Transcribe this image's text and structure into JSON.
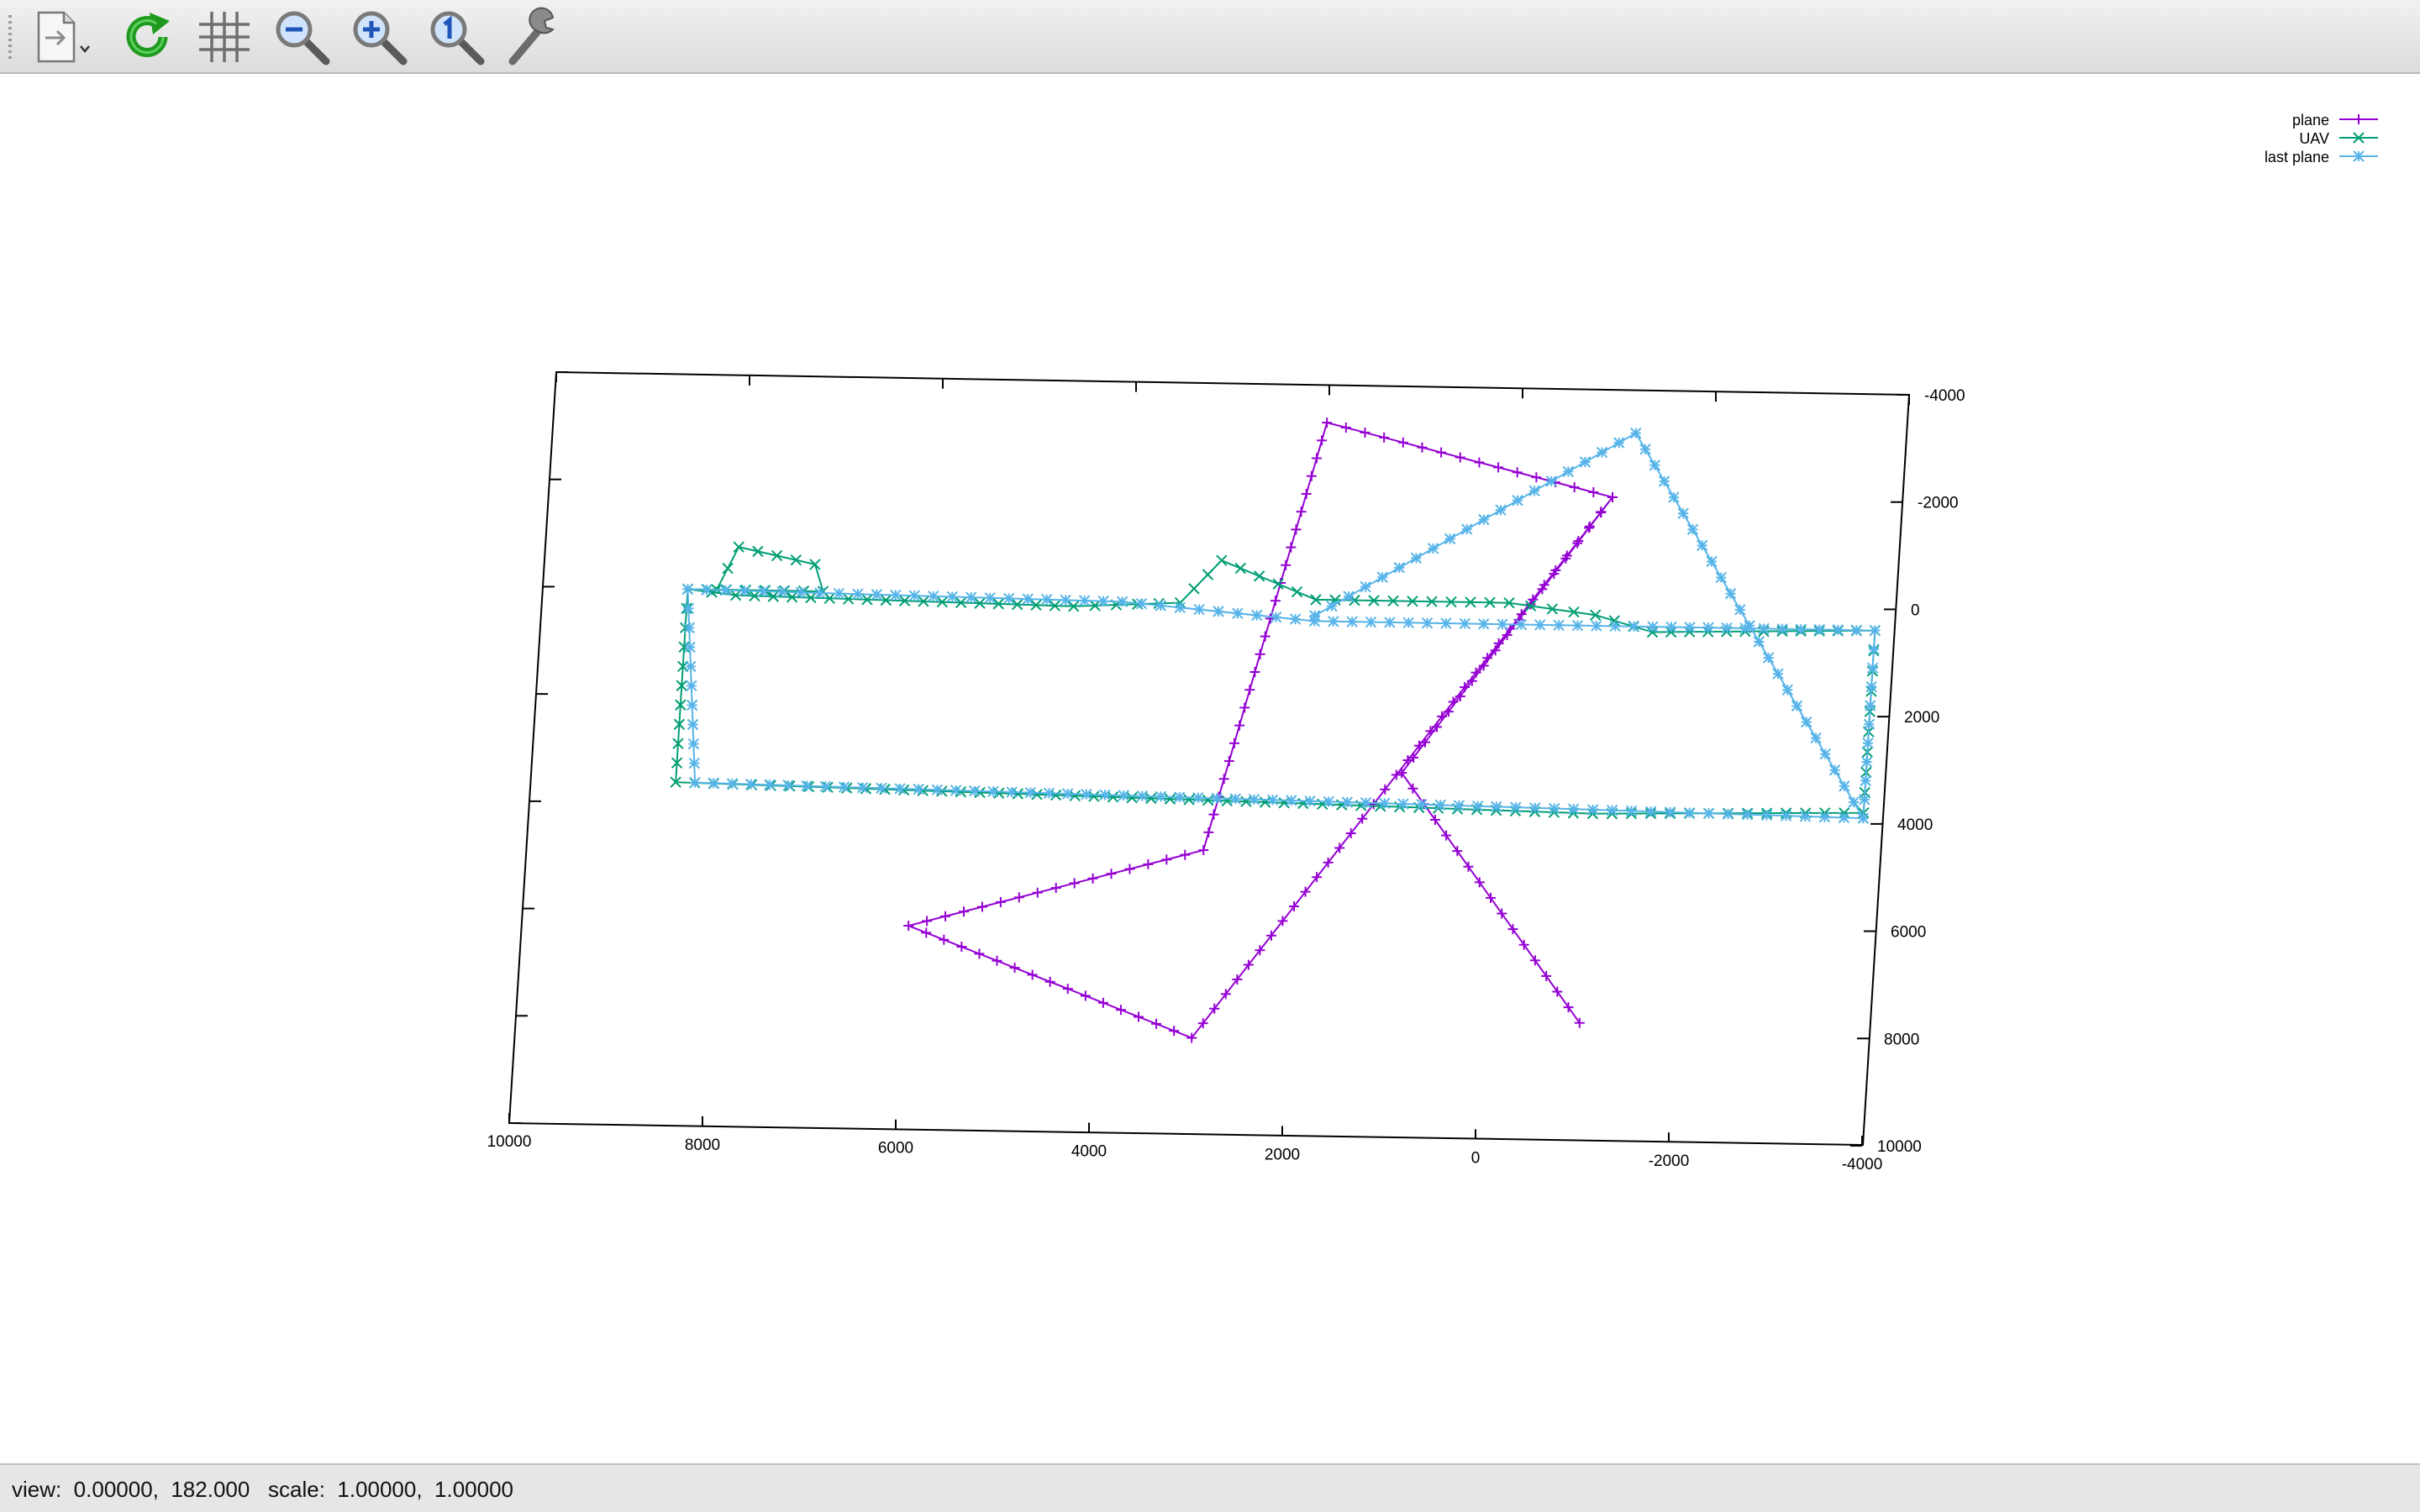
{
  "toolbar": {
    "items": [
      {
        "name": "export-menu",
        "icon": "document-export-icon"
      },
      {
        "name": "replot",
        "icon": "refresh-icon"
      },
      {
        "name": "grid",
        "icon": "grid-icon"
      },
      {
        "name": "zoom-out",
        "icon": "zoom-out-icon"
      },
      {
        "name": "zoom-in",
        "icon": "zoom-in-icon"
      },
      {
        "name": "zoom-reset",
        "icon": "zoom-1-icon"
      },
      {
        "name": "settings",
        "icon": "wrench-icon"
      }
    ]
  },
  "status": {
    "text": "view:  0.00000,  182.000   scale:  1.00000,  1.00000"
  },
  "chart_data": {
    "type": "line",
    "projection": "3d view rotated 182 degrees (gnuplot splot)",
    "x_ticks": [
      "10000",
      "8000",
      "6000",
      "4000",
      "2000",
      "0",
      "-2000",
      "-4000"
    ],
    "y_ticks": [
      "-4000",
      "-2000",
      "0",
      "2000",
      "4000",
      "6000",
      "8000",
      "10000"
    ],
    "xlim": [
      -4000,
      10000
    ],
    "ylim": [
      -4000,
      10000
    ],
    "legend": "top-right",
    "grid": false,
    "colors": {
      "plane": "#9400d3",
      "UAV": "#009e73",
      "last plane": "#56b4e9"
    },
    "series": [
      {
        "name": "plane",
        "marker": "+",
        "points": [
          [
            -1000,
            7800
          ],
          [
            1000,
            3200
          ],
          [
            -1000,
            -2000
          ],
          [
            2000,
            -3300
          ],
          [
            3000,
            4700
          ],
          [
            6000,
            6200
          ],
          [
            3000,
            8200
          ],
          [
            -1000,
            -2000
          ]
        ]
      },
      {
        "name": "UAV",
        "marker": "x",
        "points": [
          [
            8200,
            0
          ],
          [
            8000,
            -800
          ],
          [
            7200,
            -500
          ],
          [
            7100,
            0
          ],
          [
            8500,
            0
          ],
          [
            8000,
            100
          ],
          [
            4500,
            200
          ],
          [
            3400,
            100
          ],
          [
            3000,
            -700
          ],
          [
            2000,
            0
          ],
          [
            0,
            0
          ],
          [
            -900,
            200
          ],
          [
            -1500,
            500
          ],
          [
            -3800,
            400
          ],
          [
            -3800,
            3800
          ],
          [
            -1000,
            3900
          ],
          [
            2000,
            3800
          ],
          [
            8500,
            3600
          ],
          [
            8500,
            0
          ]
        ]
      },
      {
        "name": "last plane",
        "marker": "*",
        "points": [
          [
            -3800,
            3900
          ],
          [
            0,
            3800
          ],
          [
            8300,
            3600
          ],
          [
            8500,
            0
          ],
          [
            4000,
            100
          ],
          [
            2000,
            400
          ],
          [
            -1500,
            400
          ],
          [
            -3800,
            400
          ],
          [
            -3800,
            3900
          ],
          [
            -1200,
            -3200
          ],
          [
            2000,
            300
          ]
        ]
      }
    ]
  }
}
